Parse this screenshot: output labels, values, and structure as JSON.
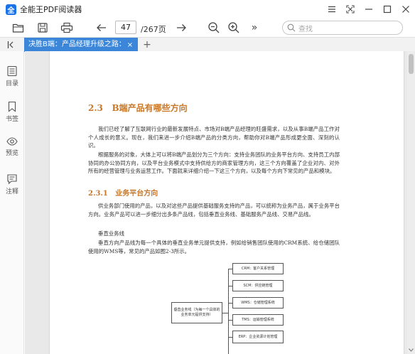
{
  "app": {
    "logo_char": "全",
    "title": "全能王PDF阅读器"
  },
  "toolbar": {
    "page_current": "47",
    "page_total": "/267页",
    "search_placeholder": "查找",
    "more_glyph": "»"
  },
  "tabbar": {
    "tab_label": "决胜B端：产品经理升级之路：",
    "close_glyph": "×",
    "add_glyph": "+"
  },
  "sidebar": {
    "items": [
      {
        "label": "目录"
      },
      {
        "label": "书签"
      },
      {
        "label": "预览"
      },
      {
        "label": "注释"
      }
    ]
  },
  "document": {
    "section_num": "2.3",
    "section_title": "B端产品有哪些方向",
    "para1": "我们已经了解了互联网行业的最新发展特点、市场对B端产品经理的旺盛需求，以及从事B端产品工作对个人成长的意义。现在，我们来进一步介绍B端产品的分类方向，帮助你对B端产品形成更全面、深刻的认识。",
    "para2": "根据服务的对象，大体上可以将B端产品划分为三个方向：支持业务团队的业务平台方向、支持员工内部协同的办公协同方向，以及平台业务模式中支持供给方的商家管理方向，这三个方向覆盖了企业对内、对外所有的经营管理与业务运营工作。下面就来详细介绍一下这三个方向，以及每个方向下常见的产品和模块。",
    "sub_num": "2.3.1",
    "sub_title": "业务平台方向",
    "para3": "供业务部门使用的产品，以及对这些产品提供基础服务支持的产品，可以统称为业务产品，属于业务平台方向。业务产品可以进一步细分出多条产品线，包括垂直业务线、基础服务产品线、交易产品线。",
    "line_title": "垂直业务线",
    "para4": "垂直方向产品线为每一个具体的垂直业务单元提供支持，例如给销售团队使用的CRM系统、给仓储团队使用的WMS等，常见的产品如图2-3所示。",
    "diagram": {
      "root": "垂直业务线（为每一个具体的业务单元提供支持）",
      "children": [
        "CRM：客户关系管理",
        "SCM：供应链管理",
        "WMS：仓储管理系统",
        "TMS：运输管理系统",
        "ERP：企业资源计划管理"
      ]
    }
  }
}
